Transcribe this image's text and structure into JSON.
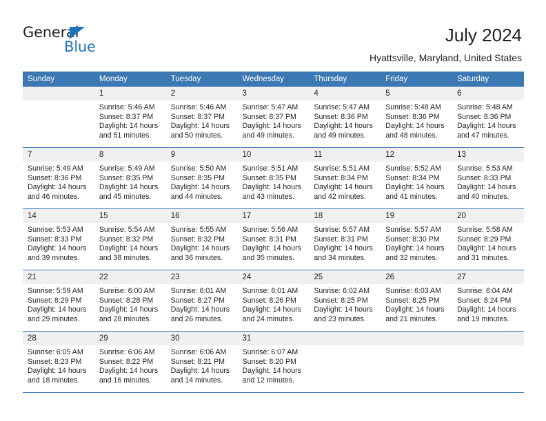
{
  "brand": {
    "name_dark": "General",
    "name_blue": "Blue",
    "color_blue": "#1c75bc"
  },
  "header": {
    "title": "July 2024",
    "subtitle": "Hyattsville, Maryland, United States",
    "header_bg": "#3c78b4",
    "daynum_bg": "#f0f0f0"
  },
  "weekday_headers": [
    "Sunday",
    "Monday",
    "Tuesday",
    "Wednesday",
    "Thursday",
    "Friday",
    "Saturday"
  ],
  "weeks": [
    [
      {
        "day": "",
        "sunrise": "",
        "sunset": "",
        "daylight1": "",
        "daylight2": ""
      },
      {
        "day": "1",
        "sunrise": "Sunrise: 5:46 AM",
        "sunset": "Sunset: 8:37 PM",
        "daylight1": "Daylight: 14 hours",
        "daylight2": "and 51 minutes."
      },
      {
        "day": "2",
        "sunrise": "Sunrise: 5:46 AM",
        "sunset": "Sunset: 8:37 PM",
        "daylight1": "Daylight: 14 hours",
        "daylight2": "and 50 minutes."
      },
      {
        "day": "3",
        "sunrise": "Sunrise: 5:47 AM",
        "sunset": "Sunset: 8:37 PM",
        "daylight1": "Daylight: 14 hours",
        "daylight2": "and 49 minutes."
      },
      {
        "day": "4",
        "sunrise": "Sunrise: 5:47 AM",
        "sunset": "Sunset: 8:36 PM",
        "daylight1": "Daylight: 14 hours",
        "daylight2": "and 49 minutes."
      },
      {
        "day": "5",
        "sunrise": "Sunrise: 5:48 AM",
        "sunset": "Sunset: 8:36 PM",
        "daylight1": "Daylight: 14 hours",
        "daylight2": "and 48 minutes."
      },
      {
        "day": "6",
        "sunrise": "Sunrise: 5:48 AM",
        "sunset": "Sunset: 8:36 PM",
        "daylight1": "Daylight: 14 hours",
        "daylight2": "and 47 minutes."
      }
    ],
    [
      {
        "day": "7",
        "sunrise": "Sunrise: 5:49 AM",
        "sunset": "Sunset: 8:36 PM",
        "daylight1": "Daylight: 14 hours",
        "daylight2": "and 46 minutes."
      },
      {
        "day": "8",
        "sunrise": "Sunrise: 5:49 AM",
        "sunset": "Sunset: 8:35 PM",
        "daylight1": "Daylight: 14 hours",
        "daylight2": "and 45 minutes."
      },
      {
        "day": "9",
        "sunrise": "Sunrise: 5:50 AM",
        "sunset": "Sunset: 8:35 PM",
        "daylight1": "Daylight: 14 hours",
        "daylight2": "and 44 minutes."
      },
      {
        "day": "10",
        "sunrise": "Sunrise: 5:51 AM",
        "sunset": "Sunset: 8:35 PM",
        "daylight1": "Daylight: 14 hours",
        "daylight2": "and 43 minutes."
      },
      {
        "day": "11",
        "sunrise": "Sunrise: 5:51 AM",
        "sunset": "Sunset: 8:34 PM",
        "daylight1": "Daylight: 14 hours",
        "daylight2": "and 42 minutes."
      },
      {
        "day": "12",
        "sunrise": "Sunrise: 5:52 AM",
        "sunset": "Sunset: 8:34 PM",
        "daylight1": "Daylight: 14 hours",
        "daylight2": "and 41 minutes."
      },
      {
        "day": "13",
        "sunrise": "Sunrise: 5:53 AM",
        "sunset": "Sunset: 8:33 PM",
        "daylight1": "Daylight: 14 hours",
        "daylight2": "and 40 minutes."
      }
    ],
    [
      {
        "day": "14",
        "sunrise": "Sunrise: 5:53 AM",
        "sunset": "Sunset: 8:33 PM",
        "daylight1": "Daylight: 14 hours",
        "daylight2": "and 39 minutes."
      },
      {
        "day": "15",
        "sunrise": "Sunrise: 5:54 AM",
        "sunset": "Sunset: 8:32 PM",
        "daylight1": "Daylight: 14 hours",
        "daylight2": "and 38 minutes."
      },
      {
        "day": "16",
        "sunrise": "Sunrise: 5:55 AM",
        "sunset": "Sunset: 8:32 PM",
        "daylight1": "Daylight: 14 hours",
        "daylight2": "and 36 minutes."
      },
      {
        "day": "17",
        "sunrise": "Sunrise: 5:56 AM",
        "sunset": "Sunset: 8:31 PM",
        "daylight1": "Daylight: 14 hours",
        "daylight2": "and 35 minutes."
      },
      {
        "day": "18",
        "sunrise": "Sunrise: 5:57 AM",
        "sunset": "Sunset: 8:31 PM",
        "daylight1": "Daylight: 14 hours",
        "daylight2": "and 34 minutes."
      },
      {
        "day": "19",
        "sunrise": "Sunrise: 5:57 AM",
        "sunset": "Sunset: 8:30 PM",
        "daylight1": "Daylight: 14 hours",
        "daylight2": "and 32 minutes."
      },
      {
        "day": "20",
        "sunrise": "Sunrise: 5:58 AM",
        "sunset": "Sunset: 8:29 PM",
        "daylight1": "Daylight: 14 hours",
        "daylight2": "and 31 minutes."
      }
    ],
    [
      {
        "day": "21",
        "sunrise": "Sunrise: 5:59 AM",
        "sunset": "Sunset: 8:29 PM",
        "daylight1": "Daylight: 14 hours",
        "daylight2": "and 29 minutes."
      },
      {
        "day": "22",
        "sunrise": "Sunrise: 6:00 AM",
        "sunset": "Sunset: 8:28 PM",
        "daylight1": "Daylight: 14 hours",
        "daylight2": "and 28 minutes."
      },
      {
        "day": "23",
        "sunrise": "Sunrise: 6:01 AM",
        "sunset": "Sunset: 8:27 PM",
        "daylight1": "Daylight: 14 hours",
        "daylight2": "and 26 minutes."
      },
      {
        "day": "24",
        "sunrise": "Sunrise: 6:01 AM",
        "sunset": "Sunset: 8:26 PM",
        "daylight1": "Daylight: 14 hours",
        "daylight2": "and 24 minutes."
      },
      {
        "day": "25",
        "sunrise": "Sunrise: 6:02 AM",
        "sunset": "Sunset: 8:25 PM",
        "daylight1": "Daylight: 14 hours",
        "daylight2": "and 23 minutes."
      },
      {
        "day": "26",
        "sunrise": "Sunrise: 6:03 AM",
        "sunset": "Sunset: 8:25 PM",
        "daylight1": "Daylight: 14 hours",
        "daylight2": "and 21 minutes."
      },
      {
        "day": "27",
        "sunrise": "Sunrise: 6:04 AM",
        "sunset": "Sunset: 8:24 PM",
        "daylight1": "Daylight: 14 hours",
        "daylight2": "and 19 minutes."
      }
    ],
    [
      {
        "day": "28",
        "sunrise": "Sunrise: 6:05 AM",
        "sunset": "Sunset: 8:23 PM",
        "daylight1": "Daylight: 14 hours",
        "daylight2": "and 18 minutes."
      },
      {
        "day": "29",
        "sunrise": "Sunrise: 6:06 AM",
        "sunset": "Sunset: 8:22 PM",
        "daylight1": "Daylight: 14 hours",
        "daylight2": "and 16 minutes."
      },
      {
        "day": "30",
        "sunrise": "Sunrise: 6:06 AM",
        "sunset": "Sunset: 8:21 PM",
        "daylight1": "Daylight: 14 hours",
        "daylight2": "and 14 minutes."
      },
      {
        "day": "31",
        "sunrise": "Sunrise: 6:07 AM",
        "sunset": "Sunset: 8:20 PM",
        "daylight1": "Daylight: 14 hours",
        "daylight2": "and 12 minutes."
      },
      {
        "day": "",
        "sunrise": "",
        "sunset": "",
        "daylight1": "",
        "daylight2": ""
      },
      {
        "day": "",
        "sunrise": "",
        "sunset": "",
        "daylight1": "",
        "daylight2": ""
      },
      {
        "day": "",
        "sunrise": "",
        "sunset": "",
        "daylight1": "",
        "daylight2": ""
      }
    ]
  ]
}
